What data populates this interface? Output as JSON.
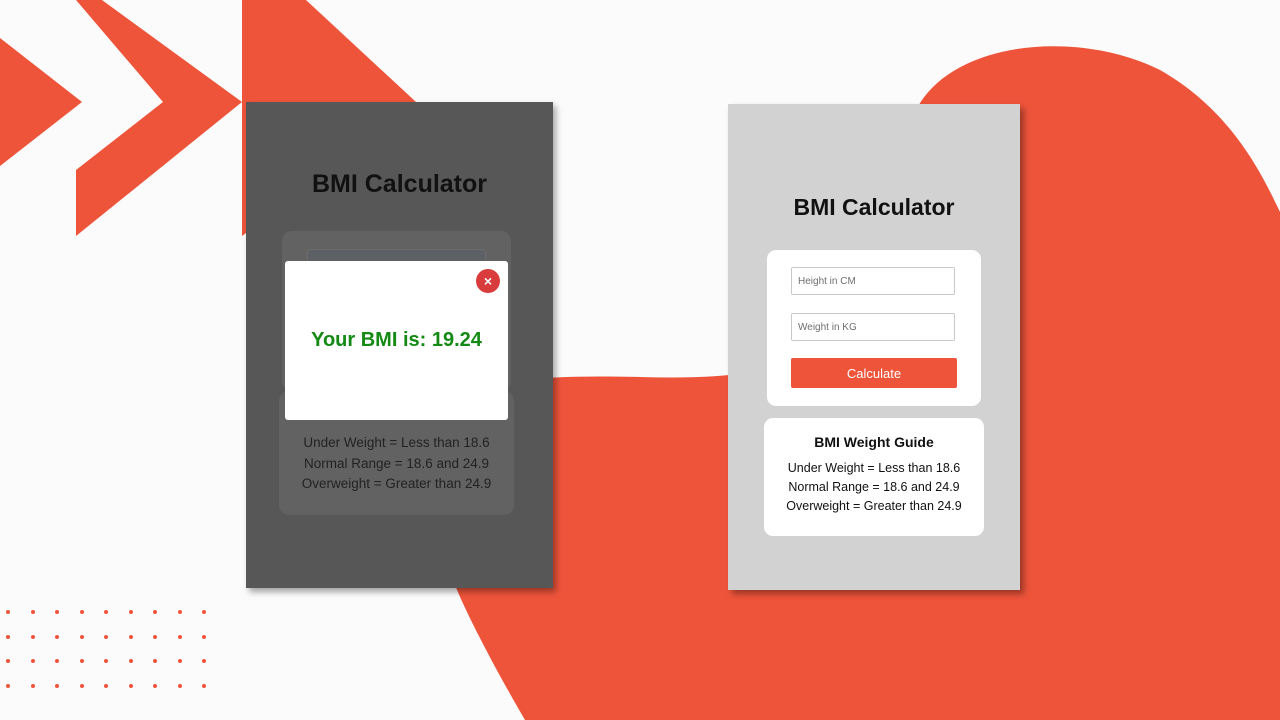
{
  "colors": {
    "accent": "#ee543a",
    "result_green": "#148a14",
    "close_red": "#d93c3c",
    "card_gray": "#d2d2d2",
    "overlay_dark": "#575757"
  },
  "left_panel": {
    "title": "BMI Calculator",
    "modal": {
      "close_icon": "×",
      "result_text": "Your BMI is: 19.24"
    },
    "guide": {
      "lines": [
        "Under Weight = Less than 18.6",
        "Normal Range = 18.6 and 24.9",
        "Overweight = Greater than 24.9"
      ]
    }
  },
  "right_panel": {
    "title": "BMI Calculator",
    "form": {
      "height_placeholder": "Height in CM",
      "weight_placeholder": "Weight in KG",
      "calculate_label": "Calculate"
    },
    "guide": {
      "heading": "BMI Weight Guide",
      "lines": [
        "Under Weight = Less than 18.6",
        "Normal Range = 18.6 and 24.9",
        "Overweight = Greater than 24.9"
      ]
    }
  }
}
